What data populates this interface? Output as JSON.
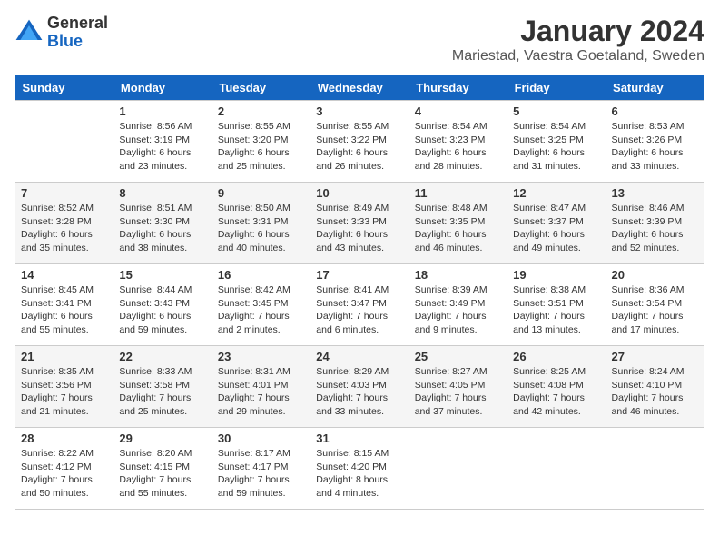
{
  "logo": {
    "general": "General",
    "blue": "Blue"
  },
  "title": "January 2024",
  "location": "Mariestad, Vaestra Goetaland, Sweden",
  "days_of_week": [
    "Sunday",
    "Monday",
    "Tuesday",
    "Wednesday",
    "Thursday",
    "Friday",
    "Saturday"
  ],
  "weeks": [
    [
      {
        "day": "",
        "sunrise": "",
        "sunset": "",
        "daylight": ""
      },
      {
        "day": "1",
        "sunrise": "Sunrise: 8:56 AM",
        "sunset": "Sunset: 3:19 PM",
        "daylight": "Daylight: 6 hours and 23 minutes."
      },
      {
        "day": "2",
        "sunrise": "Sunrise: 8:55 AM",
        "sunset": "Sunset: 3:20 PM",
        "daylight": "Daylight: 6 hours and 25 minutes."
      },
      {
        "day": "3",
        "sunrise": "Sunrise: 8:55 AM",
        "sunset": "Sunset: 3:22 PM",
        "daylight": "Daylight: 6 hours and 26 minutes."
      },
      {
        "day": "4",
        "sunrise": "Sunrise: 8:54 AM",
        "sunset": "Sunset: 3:23 PM",
        "daylight": "Daylight: 6 hours and 28 minutes."
      },
      {
        "day": "5",
        "sunrise": "Sunrise: 8:54 AM",
        "sunset": "Sunset: 3:25 PM",
        "daylight": "Daylight: 6 hours and 31 minutes."
      },
      {
        "day": "6",
        "sunrise": "Sunrise: 8:53 AM",
        "sunset": "Sunset: 3:26 PM",
        "daylight": "Daylight: 6 hours and 33 minutes."
      }
    ],
    [
      {
        "day": "7",
        "sunrise": "Sunrise: 8:52 AM",
        "sunset": "Sunset: 3:28 PM",
        "daylight": "Daylight: 6 hours and 35 minutes."
      },
      {
        "day": "8",
        "sunrise": "Sunrise: 8:51 AM",
        "sunset": "Sunset: 3:30 PM",
        "daylight": "Daylight: 6 hours and 38 minutes."
      },
      {
        "day": "9",
        "sunrise": "Sunrise: 8:50 AM",
        "sunset": "Sunset: 3:31 PM",
        "daylight": "Daylight: 6 hours and 40 minutes."
      },
      {
        "day": "10",
        "sunrise": "Sunrise: 8:49 AM",
        "sunset": "Sunset: 3:33 PM",
        "daylight": "Daylight: 6 hours and 43 minutes."
      },
      {
        "day": "11",
        "sunrise": "Sunrise: 8:48 AM",
        "sunset": "Sunset: 3:35 PM",
        "daylight": "Daylight: 6 hours and 46 minutes."
      },
      {
        "day": "12",
        "sunrise": "Sunrise: 8:47 AM",
        "sunset": "Sunset: 3:37 PM",
        "daylight": "Daylight: 6 hours and 49 minutes."
      },
      {
        "day": "13",
        "sunrise": "Sunrise: 8:46 AM",
        "sunset": "Sunset: 3:39 PM",
        "daylight": "Daylight: 6 hours and 52 minutes."
      }
    ],
    [
      {
        "day": "14",
        "sunrise": "Sunrise: 8:45 AM",
        "sunset": "Sunset: 3:41 PM",
        "daylight": "Daylight: 6 hours and 55 minutes."
      },
      {
        "day": "15",
        "sunrise": "Sunrise: 8:44 AM",
        "sunset": "Sunset: 3:43 PM",
        "daylight": "Daylight: 6 hours and 59 minutes."
      },
      {
        "day": "16",
        "sunrise": "Sunrise: 8:42 AM",
        "sunset": "Sunset: 3:45 PM",
        "daylight": "Daylight: 7 hours and 2 minutes."
      },
      {
        "day": "17",
        "sunrise": "Sunrise: 8:41 AM",
        "sunset": "Sunset: 3:47 PM",
        "daylight": "Daylight: 7 hours and 6 minutes."
      },
      {
        "day": "18",
        "sunrise": "Sunrise: 8:39 AM",
        "sunset": "Sunset: 3:49 PM",
        "daylight": "Daylight: 7 hours and 9 minutes."
      },
      {
        "day": "19",
        "sunrise": "Sunrise: 8:38 AM",
        "sunset": "Sunset: 3:51 PM",
        "daylight": "Daylight: 7 hours and 13 minutes."
      },
      {
        "day": "20",
        "sunrise": "Sunrise: 8:36 AM",
        "sunset": "Sunset: 3:54 PM",
        "daylight": "Daylight: 7 hours and 17 minutes."
      }
    ],
    [
      {
        "day": "21",
        "sunrise": "Sunrise: 8:35 AM",
        "sunset": "Sunset: 3:56 PM",
        "daylight": "Daylight: 7 hours and 21 minutes."
      },
      {
        "day": "22",
        "sunrise": "Sunrise: 8:33 AM",
        "sunset": "Sunset: 3:58 PM",
        "daylight": "Daylight: 7 hours and 25 minutes."
      },
      {
        "day": "23",
        "sunrise": "Sunrise: 8:31 AM",
        "sunset": "Sunset: 4:01 PM",
        "daylight": "Daylight: 7 hours and 29 minutes."
      },
      {
        "day": "24",
        "sunrise": "Sunrise: 8:29 AM",
        "sunset": "Sunset: 4:03 PM",
        "daylight": "Daylight: 7 hours and 33 minutes."
      },
      {
        "day": "25",
        "sunrise": "Sunrise: 8:27 AM",
        "sunset": "Sunset: 4:05 PM",
        "daylight": "Daylight: 7 hours and 37 minutes."
      },
      {
        "day": "26",
        "sunrise": "Sunrise: 8:25 AM",
        "sunset": "Sunset: 4:08 PM",
        "daylight": "Daylight: 7 hours and 42 minutes."
      },
      {
        "day": "27",
        "sunrise": "Sunrise: 8:24 AM",
        "sunset": "Sunset: 4:10 PM",
        "daylight": "Daylight: 7 hours and 46 minutes."
      }
    ],
    [
      {
        "day": "28",
        "sunrise": "Sunrise: 8:22 AM",
        "sunset": "Sunset: 4:12 PM",
        "daylight": "Daylight: 7 hours and 50 minutes."
      },
      {
        "day": "29",
        "sunrise": "Sunrise: 8:20 AM",
        "sunset": "Sunset: 4:15 PM",
        "daylight": "Daylight: 7 hours and 55 minutes."
      },
      {
        "day": "30",
        "sunrise": "Sunrise: 8:17 AM",
        "sunset": "Sunset: 4:17 PM",
        "daylight": "Daylight: 7 hours and 59 minutes."
      },
      {
        "day": "31",
        "sunrise": "Sunrise: 8:15 AM",
        "sunset": "Sunset: 4:20 PM",
        "daylight": "Daylight: 8 hours and 4 minutes."
      },
      {
        "day": "",
        "sunrise": "",
        "sunset": "",
        "daylight": ""
      },
      {
        "day": "",
        "sunrise": "",
        "sunset": "",
        "daylight": ""
      },
      {
        "day": "",
        "sunrise": "",
        "sunset": "",
        "daylight": ""
      }
    ]
  ]
}
